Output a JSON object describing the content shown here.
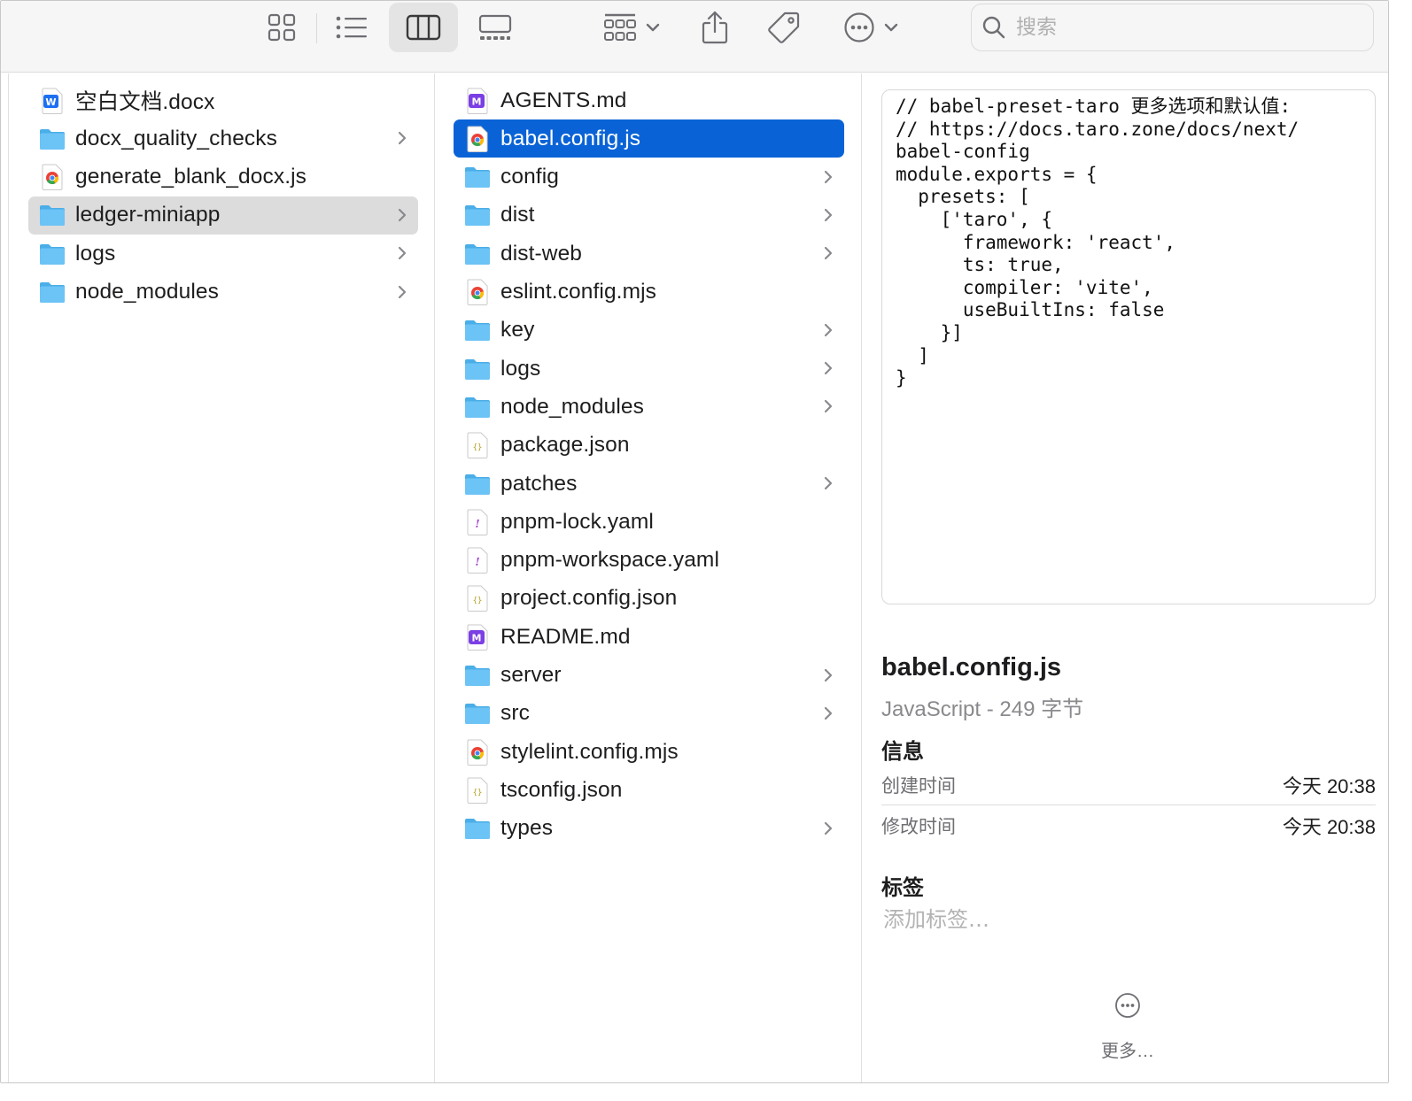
{
  "toolbar": {
    "views": [
      "icon-view",
      "list-view",
      "column-view",
      "gallery-view"
    ],
    "active_view": "column-view",
    "search_placeholder": "搜索"
  },
  "column1": [
    {
      "name": "空白文档.docx",
      "icon": "word-doc-icon",
      "folder": false,
      "state": ""
    },
    {
      "name": "docx_quality_checks",
      "icon": "folder-icon",
      "folder": true,
      "state": ""
    },
    {
      "name": "generate_blank_docx.js",
      "icon": "chrome-doc-icon",
      "folder": false,
      "state": ""
    },
    {
      "name": "ledger-miniapp",
      "icon": "folder-icon",
      "folder": true,
      "state": "path"
    },
    {
      "name": "logs",
      "icon": "folder-icon",
      "folder": true,
      "state": ""
    },
    {
      "name": "node_modules",
      "icon": "folder-icon",
      "folder": true,
      "state": ""
    }
  ],
  "column2": [
    {
      "name": "AGENTS.md",
      "icon": "markdown-doc-icon",
      "folder": false,
      "state": ""
    },
    {
      "name": "babel.config.js",
      "icon": "chrome-doc-icon",
      "folder": false,
      "state": "selected"
    },
    {
      "name": "config",
      "icon": "folder-icon",
      "folder": true,
      "state": ""
    },
    {
      "name": "dist",
      "icon": "folder-icon",
      "folder": true,
      "state": ""
    },
    {
      "name": "dist-web",
      "icon": "folder-icon",
      "folder": true,
      "state": ""
    },
    {
      "name": "eslint.config.mjs",
      "icon": "chrome-doc-icon",
      "folder": false,
      "state": ""
    },
    {
      "name": "key",
      "icon": "folder-icon",
      "folder": true,
      "state": ""
    },
    {
      "name": "logs",
      "icon": "folder-icon",
      "folder": true,
      "state": ""
    },
    {
      "name": "node_modules",
      "icon": "folder-icon",
      "folder": true,
      "state": ""
    },
    {
      "name": "package.json",
      "icon": "json-doc-icon",
      "folder": false,
      "state": ""
    },
    {
      "name": "patches",
      "icon": "folder-icon",
      "folder": true,
      "state": ""
    },
    {
      "name": "pnpm-lock.yaml",
      "icon": "yaml-doc-icon",
      "folder": false,
      "state": ""
    },
    {
      "name": "pnpm-workspace.yaml",
      "icon": "yaml-doc-icon",
      "folder": false,
      "state": ""
    },
    {
      "name": "project.config.json",
      "icon": "json-doc-icon",
      "folder": false,
      "state": ""
    },
    {
      "name": "README.md",
      "icon": "markdown-doc-icon",
      "folder": false,
      "state": ""
    },
    {
      "name": "server",
      "icon": "folder-icon",
      "folder": true,
      "state": ""
    },
    {
      "name": "src",
      "icon": "folder-icon",
      "folder": true,
      "state": ""
    },
    {
      "name": "stylelint.config.mjs",
      "icon": "chrome-doc-icon",
      "folder": false,
      "state": ""
    },
    {
      "name": "tsconfig.json",
      "icon": "json-doc-icon",
      "folder": false,
      "state": ""
    },
    {
      "name": "types",
      "icon": "folder-icon",
      "folder": true,
      "state": ""
    }
  ],
  "preview": {
    "code": "// babel-preset-taro 更多选项和默认值:\n// https://docs.taro.zone/docs/next/\nbabel-config\nmodule.exports = {\n  presets: [\n    ['taro', {\n      framework: 'react',\n      ts: true,\n      compiler: 'vite',\n      useBuiltIns: false\n    }]\n  ]\n}"
  },
  "info": {
    "filename": "babel.config.js",
    "kind": "JavaScript - 249 字节",
    "section_info": "信息",
    "created_label": "创建时间",
    "created_value": "今天 20:38",
    "modified_label": "修改时间",
    "modified_value": "今天 20:38",
    "section_tags": "标签",
    "tags_placeholder": "添加标签…",
    "more_label": "更多…"
  },
  "colors": {
    "selection": "#0a63d6",
    "path_highlight": "#dcdcdc",
    "folder": "#5ab8f0"
  }
}
